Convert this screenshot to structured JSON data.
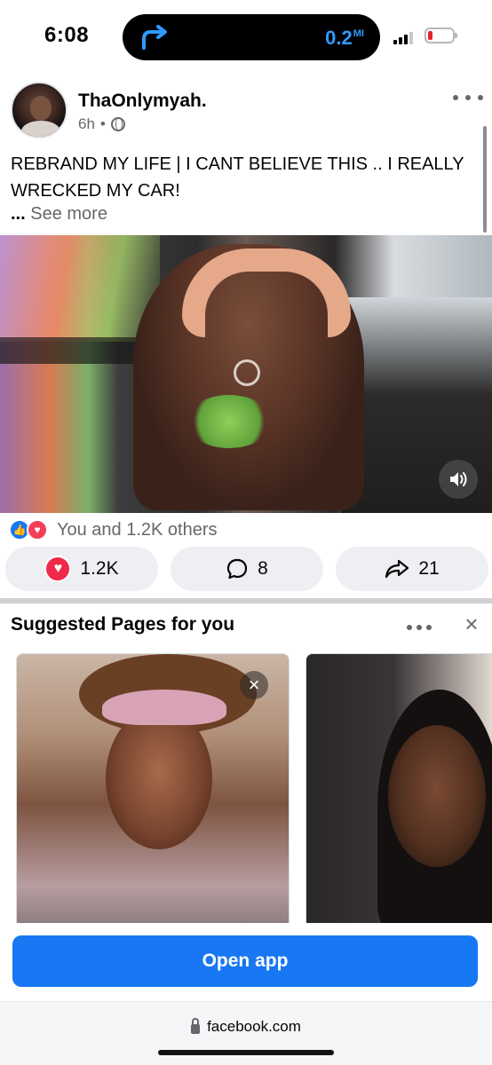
{
  "status_bar": {
    "time": "6:08",
    "nav_distance": "0.2",
    "nav_unit": "MI",
    "accent_color": "#2f9bff",
    "battery_color": "#e0262b"
  },
  "post": {
    "author": "ThaOnlymyah.",
    "age": "6h",
    "separator": "•",
    "text": "REBRAND MY LIFE | I CANT BELIEVE THIS .. I REALLY WRECKED MY CAR!",
    "see_more_ellipsis": "...",
    "see_more_label": "See more",
    "video_icons": [
      "loading-ring-icon",
      "volume-icon"
    ]
  },
  "reactions": {
    "summary": "You and 1.2K others",
    "icons": [
      "like-icon",
      "love-icon"
    ],
    "like_count": "1.2K",
    "comment_count": "8",
    "share_count": "21"
  },
  "suggested": {
    "title": "Suggested Pages for you",
    "close_glyph": "×",
    "card_close_glyph": "×"
  },
  "open_app": {
    "label": "Open app",
    "brand_color": "#1877f2"
  },
  "browser": {
    "url": "facebook.com"
  }
}
